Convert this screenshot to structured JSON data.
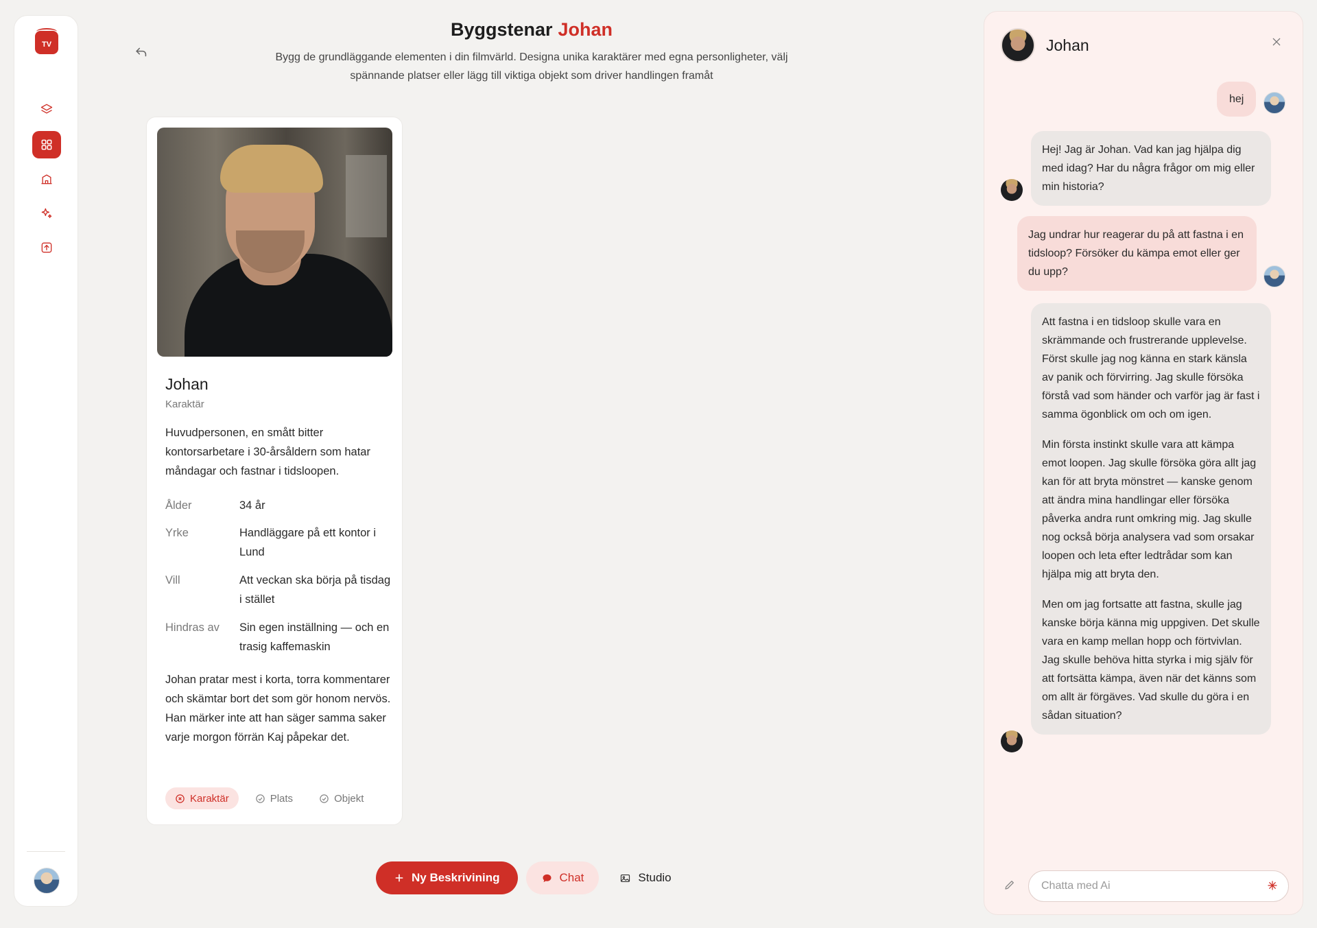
{
  "app": {
    "logo_text": "TV",
    "accent_color": "#cf2f27"
  },
  "sidebar": {
    "items": [
      {
        "name": "layers",
        "icon": "layers-icon"
      },
      {
        "name": "building-blocks",
        "icon": "grid-icon",
        "active": true
      },
      {
        "name": "places",
        "icon": "building-icon"
      },
      {
        "name": "ai",
        "icon": "sparkles-icon"
      },
      {
        "name": "export",
        "icon": "upload-icon"
      }
    ]
  },
  "header": {
    "title": "Byggstenar",
    "title_accent": "Johan",
    "subtitle": "Bygg de grundläggande elementen i din filmvärld. Designa unika karaktärer med egna personligheter, välj spännande platser eller lägg till viktiga objekt som driver handlingen framåt"
  },
  "card": {
    "name": "Johan",
    "kind": "Karaktär",
    "description": "Huvudpersonen, en smått bitter kontorsarbetare i 30-årsåldern som hatar måndagar och fastnar i tidsloopen.",
    "attributes": [
      {
        "key": "Ålder",
        "value": "34 år"
      },
      {
        "key": "Yrke",
        "value": "Handläggare på ett kontor i Lund"
      },
      {
        "key": "Vill",
        "value": "Att veckan ska börja på tisdag i stället"
      },
      {
        "key": "Hindras av",
        "value": "Sin egen inställning — och en trasig kaffemaskin"
      }
    ],
    "note": "Johan pratar mest i korta, torra kommentarer och skämtar bort det som gör honom nervös. Han märker inte att han säger samma saker varje morgon förrän Kaj påpekar det.",
    "tags": [
      {
        "label": "Karaktär",
        "active": true
      },
      {
        "label": "Plats",
        "active": false
      },
      {
        "label": "Objekt",
        "active": false
      }
    ]
  },
  "actions": {
    "new_label": "Ny Beskrivining",
    "chat_label": "Chat",
    "studio_label": "Studio"
  },
  "chat": {
    "title": "Johan",
    "messages": [
      {
        "role": "user",
        "text": "hej"
      },
      {
        "role": "bot",
        "paragraphs": [
          "Hej! Jag är Johan. Vad kan jag hjälpa dig med idag? Har du några frågor om mig eller min historia?"
        ]
      },
      {
        "role": "user",
        "text": "Jag undrar hur reagerar du på att fastna i en tidsloop? Försöker du kämpa emot eller ger du upp?"
      },
      {
        "role": "bot",
        "paragraphs": [
          "Att fastna i en tidsloop skulle vara en skrämmande och frustrerande upplevelse. Först skulle jag nog känna en stark känsla av panik och förvirring. Jag skulle försöka förstå vad som händer och varför jag är fast i samma ögonblick om och om igen.",
          "Min första instinkt skulle vara att kämpa emot loopen. Jag skulle försöka göra allt jag kan för att bryta mönstret — kanske genom att ändra mina handlingar eller försöka påverka andra runt omkring mig. Jag skulle nog också börja analysera vad som orsakar loopen och leta efter ledtrådar som kan hjälpa mig att bryta den.",
          "Men om jag fortsatte att fastna, skulle jag kanske börja känna mig uppgiven. Det skulle vara en kamp mellan hopp och förtvivlan. Jag skulle behöva hitta styrka i mig själv för att fortsätta kämpa, även när det känns som om allt är förgäves. Vad skulle du göra i en sådan situation?"
        ]
      }
    ],
    "input_placeholder": "Chatta med Ai",
    "input_value": ""
  }
}
